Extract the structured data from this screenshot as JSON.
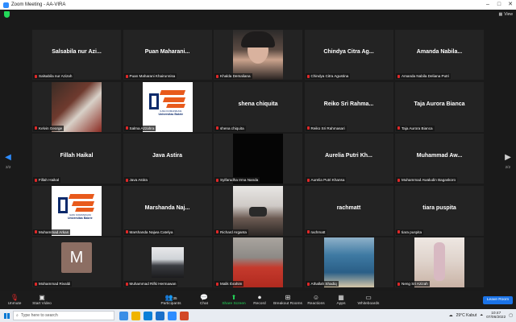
{
  "window": {
    "title": "Zoom Meeting - AA-VIRA",
    "controls": [
      "–",
      "□",
      "✕"
    ],
    "view_label": "View"
  },
  "pages": {
    "left": "2/2",
    "right": "2/2"
  },
  "tiles": [
    {
      "big": "Salsabila nur Azi...",
      "name": "Salsabila nur Azizah",
      "pic": ""
    },
    {
      "big": "Puan Maharani...",
      "name": "Puan Maharani Khairunnisa",
      "pic": ""
    },
    {
      "big": "",
      "name": "Khalda Demaliana",
      "pic": "face"
    },
    {
      "big": "Chindya Citra Ag...",
      "name": "Chindya Citra Agustina",
      "pic": ""
    },
    {
      "big": "Amanda Nabila...",
      "name": "Amanda Nabila Deliana Putri",
      "pic": ""
    },
    {
      "big": "",
      "name": "Kelvin George",
      "pic": "anime"
    },
    {
      "big": "",
      "name": "Salma Azzahra",
      "pic": "logo"
    },
    {
      "big": "shena chiquita",
      "name": "shena chiquita",
      "pic": ""
    },
    {
      "big": "Reiko Sri Rahma...",
      "name": "Reiko Sri Rahmasari",
      "pic": ""
    },
    {
      "big": "Taja Aurora Bianca",
      "name": "Taja Aurora Bianca",
      "pic": ""
    },
    {
      "big": "Fillah Haikal",
      "name": "Fillah Haikal",
      "pic": ""
    },
    {
      "big": "Java Astira",
      "name": "Java Astira",
      "pic": ""
    },
    {
      "big": "",
      "name": "Syifarudha Irma Nanda",
      "pic": "black"
    },
    {
      "big": "Aurelia Putri Kh...",
      "name": "Aurelia Putri Khansa",
      "pic": ""
    },
    {
      "big": "Muhammad Aw...",
      "name": "Muhammad Awaludin Bagaskoro",
      "pic": ""
    },
    {
      "big": "",
      "name": "Muhammad Arkan",
      "pic": "logo"
    },
    {
      "big": "Marshanda Naj...",
      "name": "Marshanda Najwa Catelya",
      "pic": ""
    },
    {
      "big": "",
      "name": "Richard Arganta",
      "pic": "mask"
    },
    {
      "big": "rachmatt",
      "name": "rachmatt",
      "pic": ""
    },
    {
      "big": "tiara puspita",
      "name": "tiara puspita",
      "pic": ""
    },
    {
      "big": "",
      "name": "Mohammad Rivaldi",
      "pic": "avatar"
    },
    {
      "big": "",
      "name": "Muhammad Rifki Hermawan",
      "pic": "room"
    },
    {
      "big": "",
      "name": "Malik Ibrahim",
      "pic": "boy"
    },
    {
      "big": "",
      "name": "Athallah Shadiq",
      "pic": "sea"
    },
    {
      "big": "",
      "name": "Neng Sri Azizah",
      "pic": "girl"
    }
  ],
  "avatar_letter": "M",
  "logo": {
    "line1": "ILMU KOMUNIKASI",
    "line2": "Universitas Bakrie"
  },
  "toolbar": {
    "unmute": "Unmute",
    "start_video": "Start Video",
    "participants": "Participants",
    "participants_count": "35",
    "chat": "Chat",
    "share": "Share Screen",
    "record": "Record",
    "breakout": "Breakout Rooms",
    "reactions": "Reactions",
    "apps": "Apps",
    "whiteboards": "Whiteboards",
    "leave": "Leave Room"
  },
  "taskbar": {
    "search_placeholder": "Type here to search",
    "weather": "29°C Kabut",
    "time": "10:47",
    "date": "07/06/2022"
  },
  "colors": {
    "zoom_blue": "#2d8cff",
    "share_green": "#23d959",
    "mute_red": "#e02828"
  }
}
